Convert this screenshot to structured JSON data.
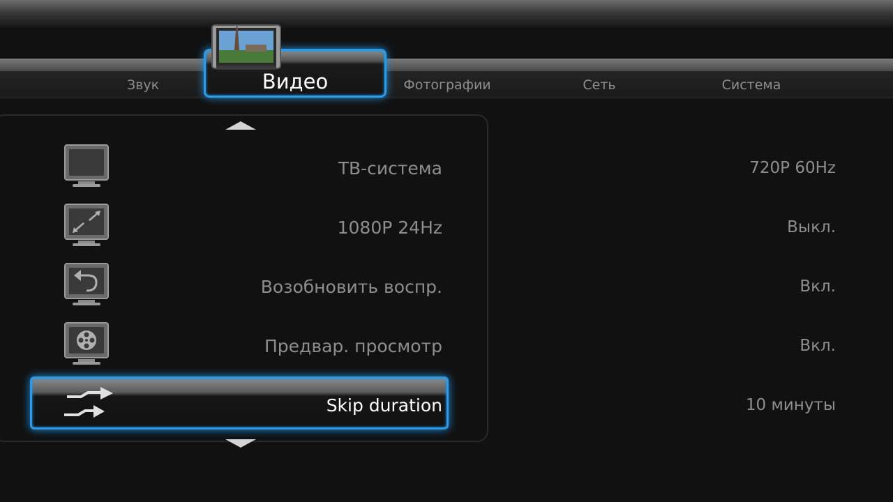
{
  "tabs": [
    {
      "label": "Звук",
      "active": false
    },
    {
      "label": "Видео",
      "active": true
    },
    {
      "label": "Фотографии",
      "active": false
    },
    {
      "label": "Сеть",
      "active": false
    },
    {
      "label": "Система",
      "active": false
    }
  ],
  "settings": [
    {
      "icon": "tv-icon",
      "label": "ТВ-система",
      "value": "720P 60Hz",
      "selected": false
    },
    {
      "icon": "resize-tv-icon",
      "label": "1080P 24Hz",
      "value": "Выкл.",
      "selected": false
    },
    {
      "icon": "resume-tv-icon",
      "label": "Возобновить воспр.",
      "value": "Вкл.",
      "selected": false
    },
    {
      "icon": "film-reel-tv-icon",
      "label": "Предвар. просмотр",
      "value": "Вкл.",
      "selected": false
    },
    {
      "icon": "skip-arrows-icon",
      "label": "Skip duration",
      "value": "10 минуты",
      "selected": true
    }
  ],
  "colors": {
    "accent": "#2b9be8",
    "background": "#111111"
  }
}
